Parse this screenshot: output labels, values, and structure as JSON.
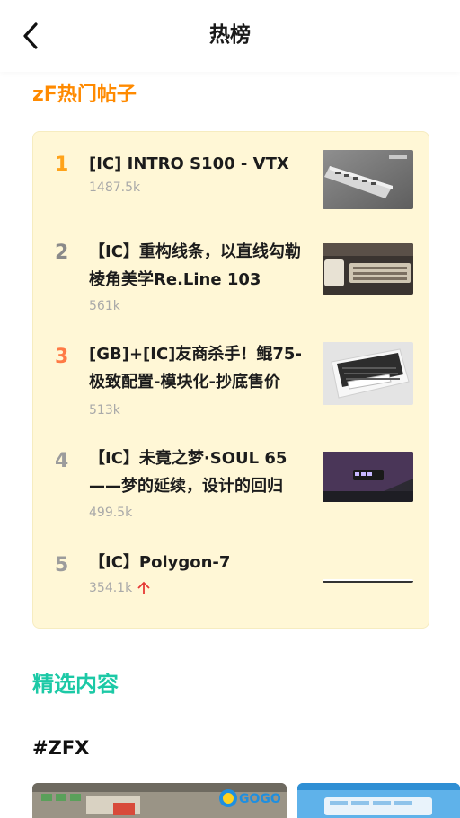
{
  "header": {
    "title": "热榜"
  },
  "hot_section": {
    "title": "zF热门帖子",
    "items": [
      {
        "rank": "1",
        "rank_color": "#ffa31a",
        "title": "[IC] INTRO S100 - VTX",
        "hot": "1487.5k"
      },
      {
        "rank": "2",
        "rank_color": "#8a8a8a",
        "title": "【IC】重构线条，以直线勾勒棱角美学Re.Line 103",
        "hot": "561k"
      },
      {
        "rank": "3",
        "rank_color": "#ff7a45",
        "title": "[GB]+[IC]友商杀手！鲲75-极致配置-模块化-抄底售价",
        "hot": "513k"
      },
      {
        "rank": "4",
        "rank_color": "#9c9c9c",
        "title": "【IC】未竟之梦·SOUL 65——梦的延续，设计的回归",
        "hot": "499.5k"
      },
      {
        "rank": "5",
        "rank_color": "#9c9c9c",
        "title": "【IC】Polygon-7",
        "hot": "354.1k"
      }
    ]
  },
  "featured": {
    "title": "精选内容",
    "tag": "#ZFX",
    "tile_brand": "GOGO"
  }
}
